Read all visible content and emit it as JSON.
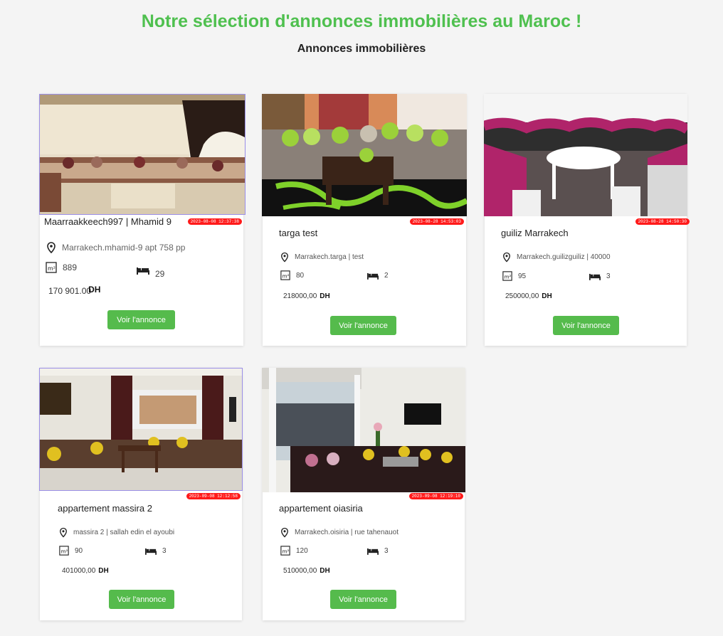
{
  "page": {
    "title": "Notre sélection d'annonces immobilières au Maroc !",
    "subtitle": "Annonces immobilières"
  },
  "colors": {
    "accent": "#4fc04f",
    "button": "#55bb4c",
    "stamp": "#ff1a1a"
  },
  "icons": {
    "location": "location-pin-icon",
    "area": "area-m2-icon",
    "beds": "bed-icon"
  },
  "listings": [
    {
      "title": "Maarraakkeech997 | Mhamid 9",
      "timestamp": "2023-08-08 12:37:38",
      "address": "Marrakech.mhamid-9 apt 758 pp",
      "area": "889",
      "beds": "29",
      "price": "170 901.00",
      "currency": "DH",
      "button": "Voir l'annonce"
    },
    {
      "title": "targa test",
      "timestamp": "2023-08-28 14:53:03",
      "address": "Marrakech.targa | test",
      "area": "80",
      "beds": "2",
      "price": "218000,00",
      "currency": "DH",
      "button": "Voir l'annonce"
    },
    {
      "title": "guiliz Marrakech",
      "timestamp": "2023-08-28 14:50:30",
      "address": "Marrakech.guilizguiliz | 40000",
      "area": "95",
      "beds": "3",
      "price": "250000,00",
      "currency": "DH",
      "button": "Voir l'annonce"
    },
    {
      "title": "appartement massira 2",
      "timestamp": "2023-09-08 12:12:58",
      "address": "massira 2 | sallah edin el ayoubi",
      "area": "90",
      "beds": "3",
      "price": "401000,00",
      "currency": "DH",
      "button": "Voir l'annonce"
    },
    {
      "title": "appartement oiasiria",
      "timestamp": "2023-09-08 12:19:10",
      "address": "Marrakech.oisiria | rue tahenauot",
      "area": "120",
      "beds": "3",
      "price": "510000,00",
      "currency": "DH",
      "button": "Voir l'annonce"
    }
  ]
}
